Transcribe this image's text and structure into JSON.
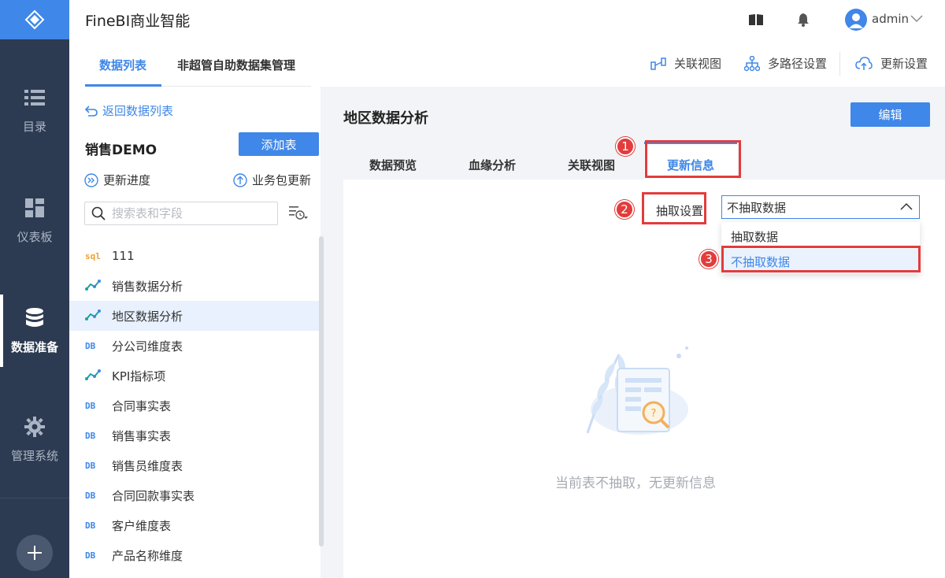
{
  "app": {
    "title": "FineBI商业智能",
    "username": "admin"
  },
  "nav": {
    "items": [
      {
        "label": "目录",
        "icon": "list-icon"
      },
      {
        "label": "仪表板",
        "icon": "dashboard-icon"
      },
      {
        "label": "数据准备",
        "icon": "database-icon"
      },
      {
        "label": "管理系统",
        "icon": "gear-icon"
      }
    ],
    "active": "数据准备"
  },
  "subheader": {
    "tabs": [
      "数据列表",
      "非超管自助数据集管理"
    ],
    "actions": [
      "关联视图",
      "多路径设置",
      "更新设置"
    ]
  },
  "left": {
    "back_label": "返回数据列表",
    "package_name": "销售DEMO",
    "add_table": "添加表",
    "update_progress": "更新进度",
    "package_update": "业务包更新",
    "search_placeholder": "搜索表和字段",
    "tables": [
      {
        "icon": "sql",
        "name": "111"
      },
      {
        "icon": "self",
        "name": "销售数据分析"
      },
      {
        "icon": "self",
        "name": "地区数据分析",
        "selected": true
      },
      {
        "icon": "db",
        "name": "分公司维度表"
      },
      {
        "icon": "self",
        "name": "KPI指标项"
      },
      {
        "icon": "db",
        "name": "合同事实表"
      },
      {
        "icon": "db",
        "name": "销售事实表"
      },
      {
        "icon": "db",
        "name": "销售员维度表"
      },
      {
        "icon": "db",
        "name": "合同回款事实表"
      },
      {
        "icon": "db",
        "name": "客户维度表"
      },
      {
        "icon": "db",
        "name": "产品名称维度"
      }
    ],
    "icon_text": {
      "sql": "sql",
      "db": "DB"
    }
  },
  "content": {
    "title": "地区数据分析",
    "edit_label": "编辑",
    "tabs": [
      "数据预览",
      "血缘分析",
      "关联视图",
      "更新信息"
    ],
    "active_tab": "更新信息",
    "extract_label": "抽取设置",
    "select_value": "不抽取数据",
    "options": [
      "抽取数据",
      "不抽取数据"
    ],
    "selected_option": "不抽取数据",
    "empty_text": "当前表不抽取，无更新信息"
  },
  "annotations": [
    "1",
    "2",
    "3"
  ],
  "colors": {
    "accent": "#3f87e8",
    "nav_bg": "#2d3b52",
    "annotation": "#e23c3c"
  }
}
